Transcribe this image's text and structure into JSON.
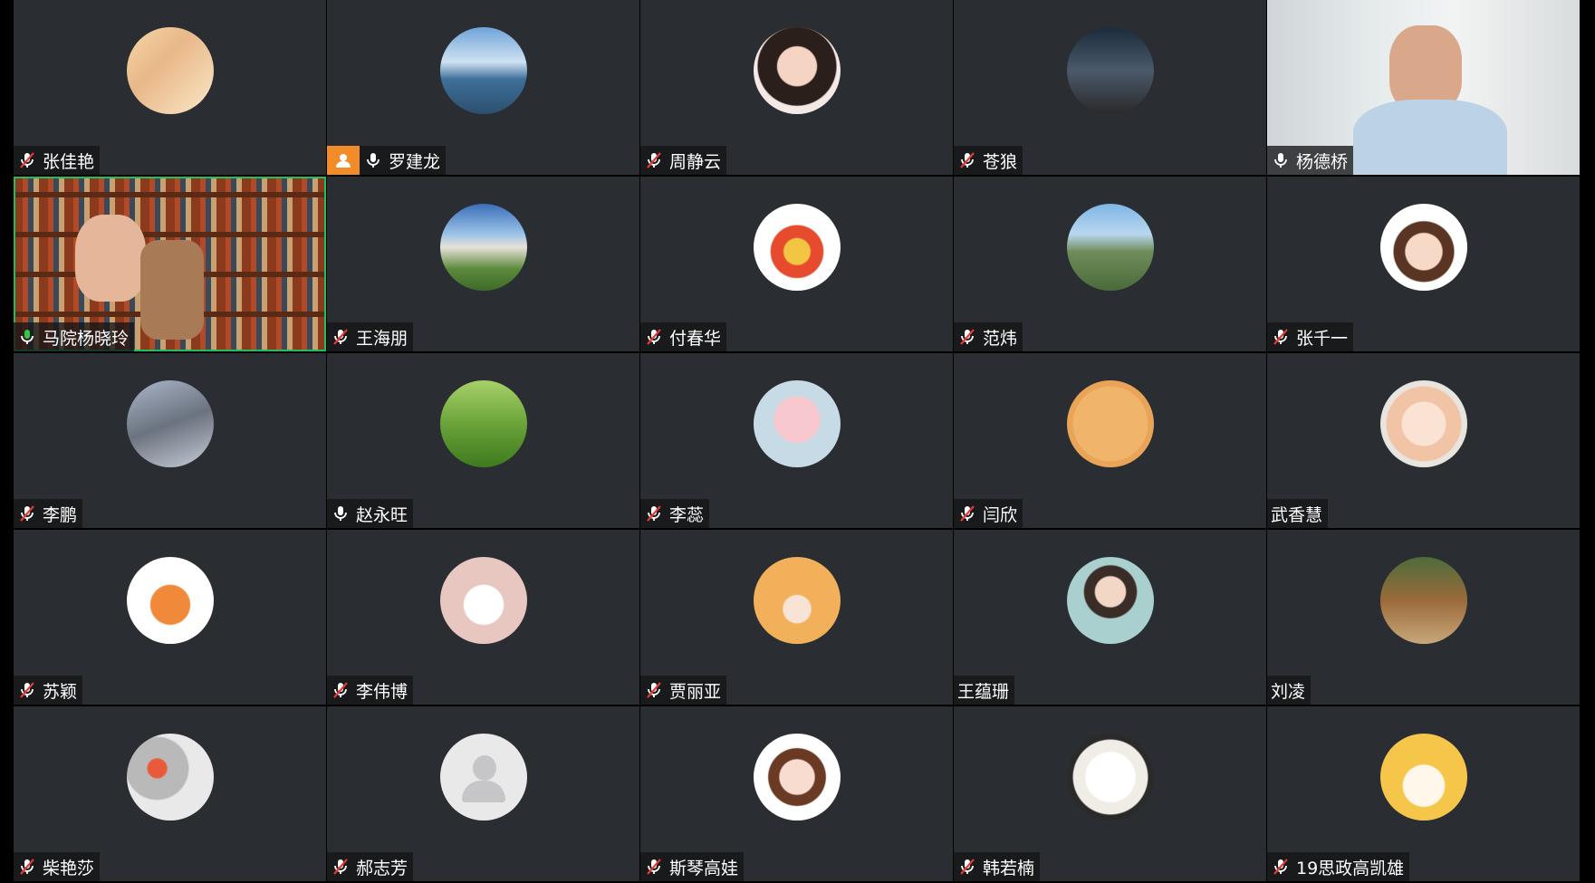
{
  "colors": {
    "tile_bg": "#2a2d31",
    "speaking_border": "#1fbf5a",
    "host_badge": "#f28c28"
  },
  "participants": [
    {
      "name": "张佳艳",
      "mic": "muted",
      "avatar": "linear-gradient(135deg,#f6d7a8,#e8b888 40%,#fbe7c7)"
    },
    {
      "name": "罗建龙",
      "mic": "on",
      "host": true,
      "avatar": "linear-gradient(180deg,#6fa3d8 0%,#cfe2f3 40%,#3f6f9a 60%,#2c4f6e 100%)"
    },
    {
      "name": "周静云",
      "mic": "muted",
      "avatar": "radial-gradient(circle at 50% 45%,#f6d4c4 0 30%,#2b1f1c 32% 60%,#f4e9e4 62%)"
    },
    {
      "name": "苍狼",
      "mic": "muted",
      "avatar": "linear-gradient(180deg,#1b2b3c 0%,#4a5a6a 50%,#2a2a2a 100%)"
    },
    {
      "name": "杨德桥",
      "mic": "on",
      "video": "a"
    },
    {
      "name": "马院杨晓玲",
      "mic": "speaking",
      "video": "b",
      "speaking": true
    },
    {
      "name": "王海朋",
      "mic": "muted",
      "avatar": "linear-gradient(180deg,#3a6fb8 0%,#9cc3e8 35%,#e7e2d8 50%,#5b8a3c 75%,#3f6a2a 100%)"
    },
    {
      "name": "付春华",
      "mic": "muted",
      "avatar": "radial-gradient(circle at 50% 55%,#f4c542 0 20%,#e54b2c 22% 40%,#ffffff 42%)"
    },
    {
      "name": "范炜",
      "mic": "muted",
      "avatar": "linear-gradient(180deg,#7fb5e6 0%,#b8d7ee 35%,#6f8d5a 55%,#4b6a3a 100%)"
    },
    {
      "name": "张千一",
      "mic": "muted",
      "avatar": "radial-gradient(circle at 50% 55%,#f7d9c8 0 28%,#5a3524 30% 46%,#ffffff 48%)"
    },
    {
      "name": "李鹏",
      "mic": "muted",
      "avatar": "linear-gradient(160deg,#aab6c8 0%,#6b7380 50%,#c8cdd6 100%)"
    },
    {
      "name": "赵永旺",
      "mic": "on",
      "avatar": "linear-gradient(180deg,#a7d16a 0%,#6aa33a 50%,#3e7a1e 100%)"
    },
    {
      "name": "李蕊",
      "mic": "muted",
      "avatar": "radial-gradient(circle at 50% 45%,#f7c9cf 0 35%,#c7dbe6 37%)"
    },
    {
      "name": "闫欣",
      "mic": "muted",
      "avatar": "radial-gradient(circle at 50% 50%,#f0b56b 0 60%,#e9a457 62%)"
    },
    {
      "name": "武香慧",
      "mic": "none",
      "avatar": "radial-gradient(circle at 50% 50%,#fbe3d3 0 35%,#f2c4a6 37% 60%,#e8e4df 62%)"
    },
    {
      "name": "苏颖",
      "mic": "muted",
      "avatar": "radial-gradient(circle at 50% 55%,#f08a3a 0 30%,#ffffff 32%)"
    },
    {
      "name": "李伟博",
      "mic": "muted",
      "avatar": "radial-gradient(circle at 50% 55%,#ffffff 0 30%,#e8c7c0 32%)"
    },
    {
      "name": "贾丽亚",
      "mic": "muted",
      "avatar": "radial-gradient(circle at 50% 60%,#f7e4d6 0 20%,#f2b05a 22%)"
    },
    {
      "name": "王蕴珊",
      "mic": "none",
      "avatar": "radial-gradient(circle at 50% 40%,#f3d7c6 0 22%,#3a2c26 24% 38%,#a9cfcf 40%)"
    },
    {
      "name": "刘凌",
      "mic": "none",
      "avatar": "linear-gradient(180deg,#4d6b3a 0%,#9b6b3a 50%,#c8a77a 100%)"
    },
    {
      "name": "柴艳莎",
      "mic": "muted",
      "avatar": "radial-gradient(circle at 35% 40%,#e85a3a 0 12%,#b9b9b9 14% 40%,#e9e9e9 42%)"
    },
    {
      "name": "郝志芳",
      "mic": "muted",
      "default_avatar": true
    },
    {
      "name": "斯琴高娃",
      "mic": "muted",
      "avatar": "radial-gradient(circle at 50% 50%,#f8dcd0 0 28%,#6b3a24 30% 46%,#ffffff 48%)"
    },
    {
      "name": "韩若楠",
      "mic": "muted",
      "avatar": "radial-gradient(circle at 50% 50%,#ffffff 0 40%,#f0ece6 42% 60%,#2a2a2a 62%)"
    },
    {
      "name": "19思政高凯雄",
      "mic": "muted",
      "avatar": "radial-gradient(circle at 50% 60%,#fff8ea 0 30%,#f6c64b 32%)"
    }
  ]
}
